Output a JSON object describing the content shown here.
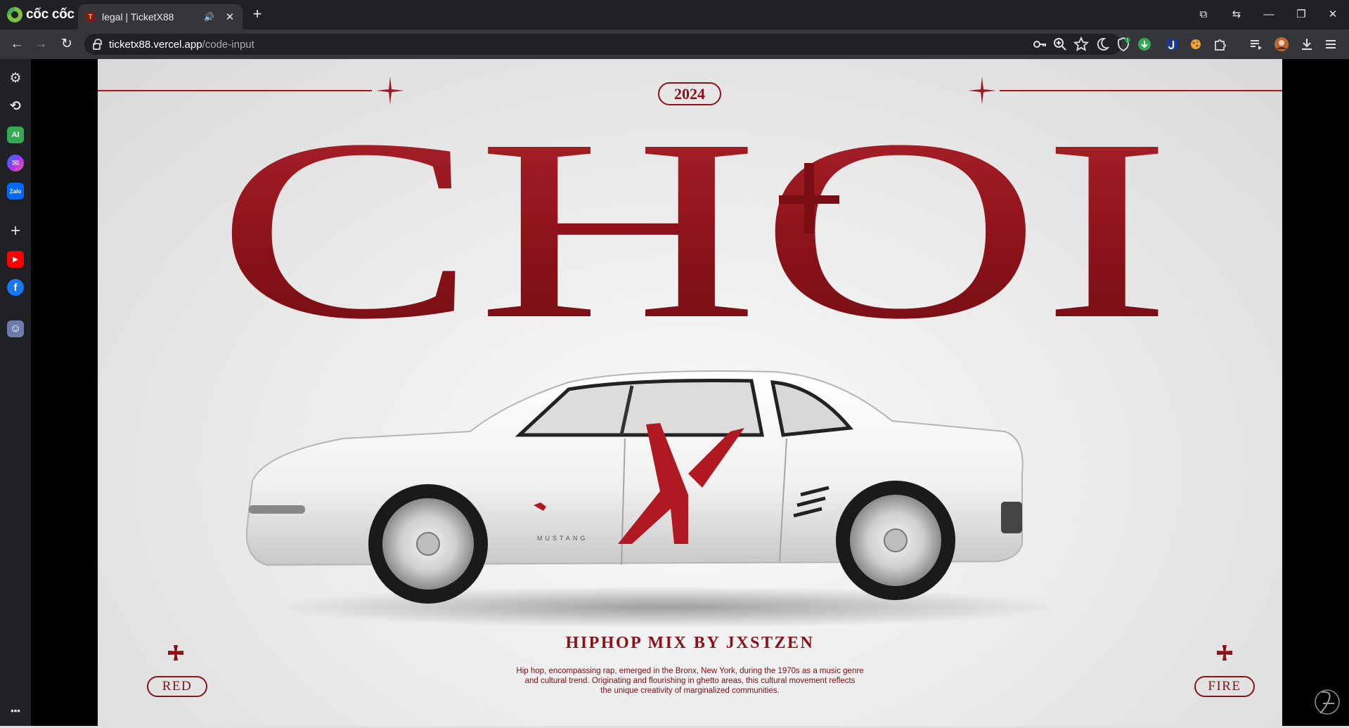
{
  "browser": {
    "brand": "cốc cốc",
    "tab": {
      "title": "legal | TicketX88",
      "audio_glyph": "🔊",
      "close_glyph": "✕"
    },
    "new_tab_glyph": "+",
    "window_controls": {
      "tab_search": "⧉",
      "history": "⇆",
      "minimize": "—",
      "restore": "❐",
      "close": "✕"
    },
    "nav": {
      "back": "←",
      "forward": "→",
      "reload": "↻"
    },
    "address": {
      "host": "ticketx88.vercel.app",
      "path": "/code-input"
    },
    "toolbar_icons": [
      "key-icon",
      "zoom-icon",
      "star-icon",
      "moon-icon",
      "shield-badge-icon",
      "download-green-icon",
      "j-extension-icon",
      "cookie-icon",
      "puzzle-icon",
      "playlist-icon",
      "profile-avatar-icon",
      "download-icon",
      "menu-icon"
    ],
    "extension_badge": "1"
  },
  "sidebar": {
    "items": [
      {
        "name": "settings",
        "glyph": "⚙"
      },
      {
        "name": "history",
        "glyph": "⟲"
      },
      {
        "name": "ai",
        "label": "AI"
      },
      {
        "name": "messenger",
        "glyph": "✉"
      },
      {
        "name": "zalo",
        "label": "Zalo"
      },
      {
        "name": "add",
        "glyph": "+"
      },
      {
        "name": "youtube",
        "glyph": "▶"
      },
      {
        "name": "facebook",
        "label": "f"
      },
      {
        "name": "profile",
        "glyph": "☺"
      }
    ],
    "more": "•••"
  },
  "hero": {
    "year": "2024",
    "title": "CHOI",
    "subtitle": "HIPHOP MIX BY JXSTZEN",
    "description_lines": [
      "Hip hop, encompassing rap, emerged in the Bronx, New York,  during the 1970s as a music genre",
      "and cultural trend. Originating and flourishing in ghetto areas, this cultural movement reflects",
      "the unique creativity of marginalized communities."
    ],
    "left_tag": "RED",
    "right_tag": "FIRE",
    "car_badge": "MUSTANG",
    "colors": {
      "accent": "#8a1219",
      "background": "#e9e9e9"
    }
  }
}
